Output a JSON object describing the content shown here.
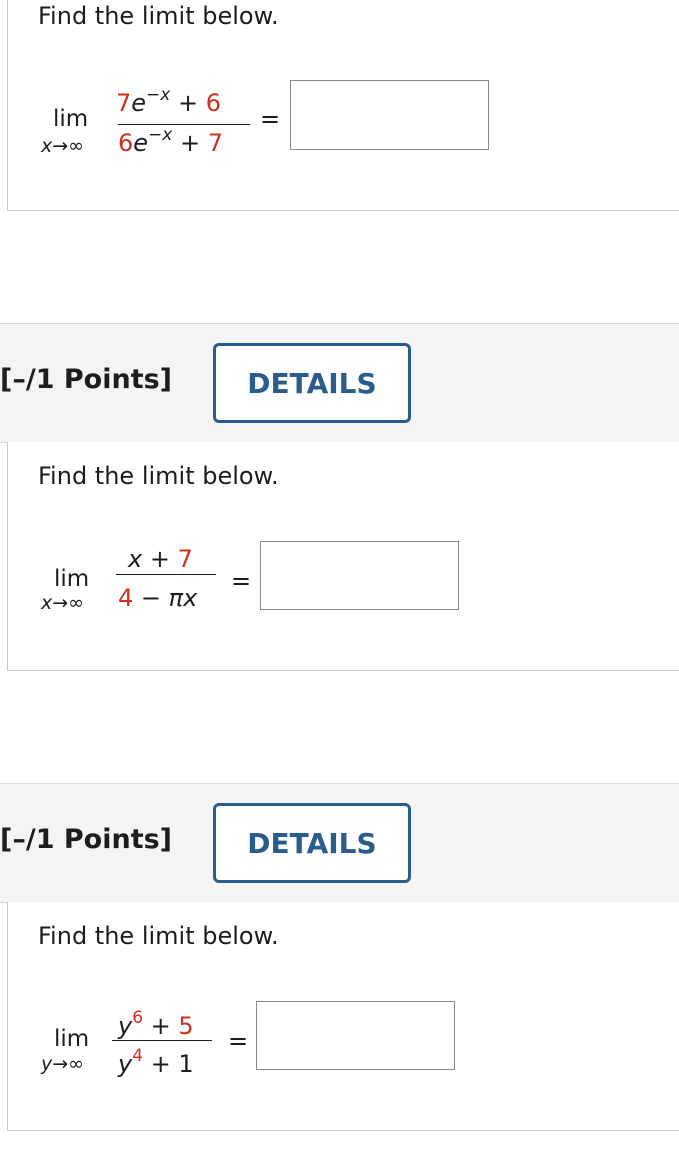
{
  "questions": [
    {
      "prompt": "Find the limit below.",
      "lim": "lim",
      "sub_var": "x",
      "sub_arrow": "→",
      "sub_inf": "∞",
      "num": {
        "coef": "7",
        "base": "e",
        "exp": "−x",
        "op": "+",
        "const": "6"
      },
      "den": {
        "coef": "6",
        "base": "e",
        "exp": "−x",
        "op": "+",
        "const": "7"
      },
      "eq": "=",
      "answer_value": ""
    },
    {
      "points": "[–/1 Points]",
      "details": "DETAILS",
      "prompt": "Find the limit below.",
      "lim": "lim",
      "sub_var": "x",
      "sub_arrow": "→",
      "sub_inf": "∞",
      "num": {
        "var": "x",
        "op": "+",
        "const": "7"
      },
      "den": {
        "const": "4",
        "op": "−",
        "coef": "π",
        "var": "x"
      },
      "eq": "=",
      "answer_value": ""
    },
    {
      "points": "[–/1 Points]",
      "details": "DETAILS",
      "prompt": "Find the limit below.",
      "lim": "lim",
      "sub_var": "y",
      "sub_arrow": "→",
      "sub_inf": "∞",
      "num": {
        "var": "y",
        "exp": "6",
        "op": "+",
        "const": "5"
      },
      "den": {
        "var": "y",
        "exp": "4",
        "op": "+",
        "const": "1"
      },
      "eq": "=",
      "answer_value": ""
    }
  ],
  "colors": {
    "accent": "#2a5c8e",
    "highlight": "#d0311f",
    "header_bg": "#f4f4f4"
  }
}
